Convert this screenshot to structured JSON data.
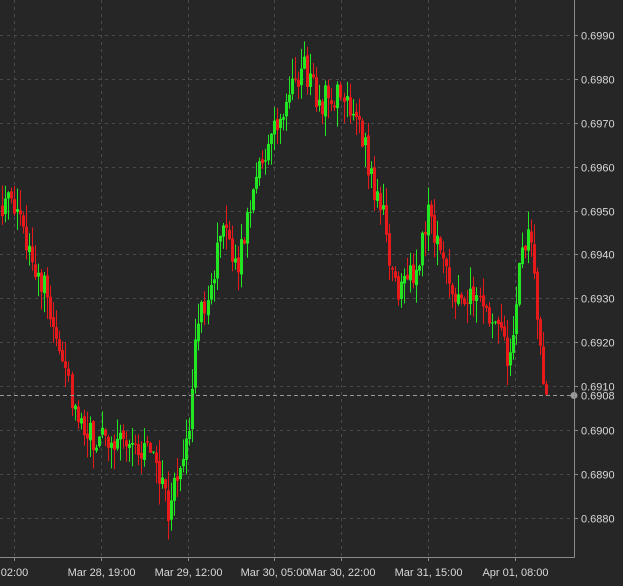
{
  "chart_data": {
    "type": "candlestick",
    "title": "",
    "xlabel": "",
    "ylabel": "",
    "ylim": [
      0.6871,
      0.6998
    ],
    "grid": true,
    "colors": {
      "background": "#262626",
      "grid": "#4a4a4a",
      "axis": "#8a8a8a",
      "text": "#d8d8d8",
      "up": "#22e622",
      "down": "#e61a1a",
      "last_price_line": "#9a9a9a",
      "price_tag": "#262626"
    },
    "y_ticks": [
      "0.6880",
      "0.6890",
      "0.6900",
      "0.6910",
      "0.6920",
      "0.6930",
      "0.6940",
      "0.6950",
      "0.6960",
      "0.6970",
      "0.6980",
      "0.6990"
    ],
    "x_ticks": [
      "02:00",
      "Mar 28, 19:00",
      "Mar 29, 12:00",
      "Mar 30, 05:00",
      "Mar 30, 22:00",
      "Mar 31, 15:00",
      "Apr 01, 08:00"
    ],
    "last_price": 0.6908,
    "last_price_label": "0.6908",
    "control_points": [
      [
        0,
        0.6952
      ],
      [
        4,
        0.695
      ],
      [
        9,
        0.6942
      ],
      [
        15,
        0.693
      ],
      [
        21,
        0.6915
      ],
      [
        25,
        0.69
      ],
      [
        32,
        0.6897
      ],
      [
        40,
        0.6899
      ],
      [
        45,
        0.6895
      ],
      [
        50,
        0.6896
      ],
      [
        55,
        0.6882
      ],
      [
        57,
        0.6886
      ],
      [
        62,
        0.6902
      ],
      [
        65,
        0.6925
      ],
      [
        68,
        0.6932
      ],
      [
        73,
        0.6945
      ],
      [
        76,
        0.6938
      ],
      [
        79,
        0.694
      ],
      [
        84,
        0.696
      ],
      [
        89,
        0.6966
      ],
      [
        95,
        0.6975
      ],
      [
        100,
        0.6983
      ],
      [
        104,
        0.6975
      ],
      [
        109,
        0.6976
      ],
      [
        114,
        0.6975
      ],
      [
        118,
        0.6972
      ],
      [
        121,
        0.696
      ],
      [
        126,
        0.6948
      ],
      [
        130,
        0.6932
      ],
      [
        137,
        0.6936
      ],
      [
        141,
        0.6951
      ],
      [
        145,
        0.694
      ],
      [
        150,
        0.6932
      ],
      [
        158,
        0.6928
      ],
      [
        163,
        0.6924
      ],
      [
        168,
        0.6915
      ],
      [
        171,
        0.6935
      ],
      [
        174,
        0.6946
      ],
      [
        178,
        0.692
      ],
      [
        180,
        0.6907
      ]
    ],
    "candle_count": 181
  }
}
